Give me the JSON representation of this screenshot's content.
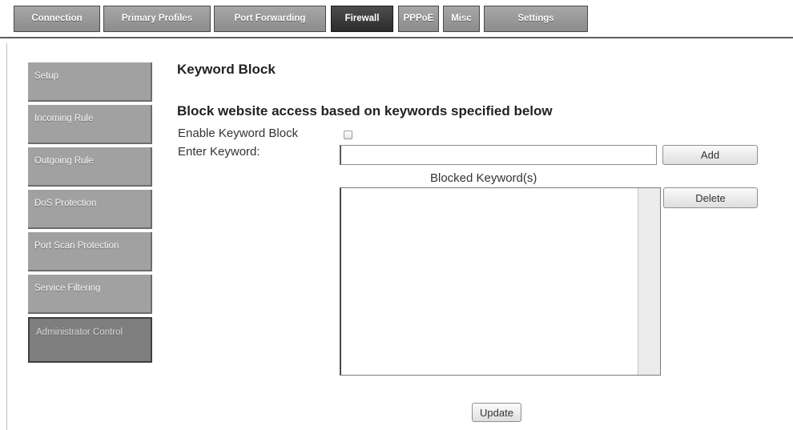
{
  "tabs": [
    {
      "label": "Connection",
      "active": false
    },
    {
      "label": "Primary Profiles",
      "active": false
    },
    {
      "label": "Port Forwarding",
      "active": false
    },
    {
      "label": "Firewall",
      "active": true
    },
    {
      "label": "PPPoE",
      "active": false
    },
    {
      "label": "Misc",
      "active": false
    },
    {
      "label": "Settings",
      "active": false
    }
  ],
  "sidebar": {
    "items": [
      {
        "label": "Setup",
        "active": false
      },
      {
        "label": "Incoming Rule",
        "active": false
      },
      {
        "label": "Outgoing Rule",
        "active": false
      },
      {
        "label": "DoS Protection",
        "active": false
      },
      {
        "label": "Port Scan Protection",
        "active": false
      },
      {
        "label": "Service Filtering",
        "active": false
      },
      {
        "label": "Administrator Control",
        "active": true
      }
    ]
  },
  "main": {
    "title": "Keyword Block",
    "section_title": "Block website access based on keywords specified below",
    "enable_label": "Enable Keyword Block",
    "enable_checked": false,
    "keyword_label": "Enter Keyword:",
    "keyword_value": "",
    "add_label": "Add",
    "blocked_heading": "Blocked Keyword(s)",
    "blocked_keywords": [],
    "delete_label": "Delete",
    "update_label": "Update"
  }
}
